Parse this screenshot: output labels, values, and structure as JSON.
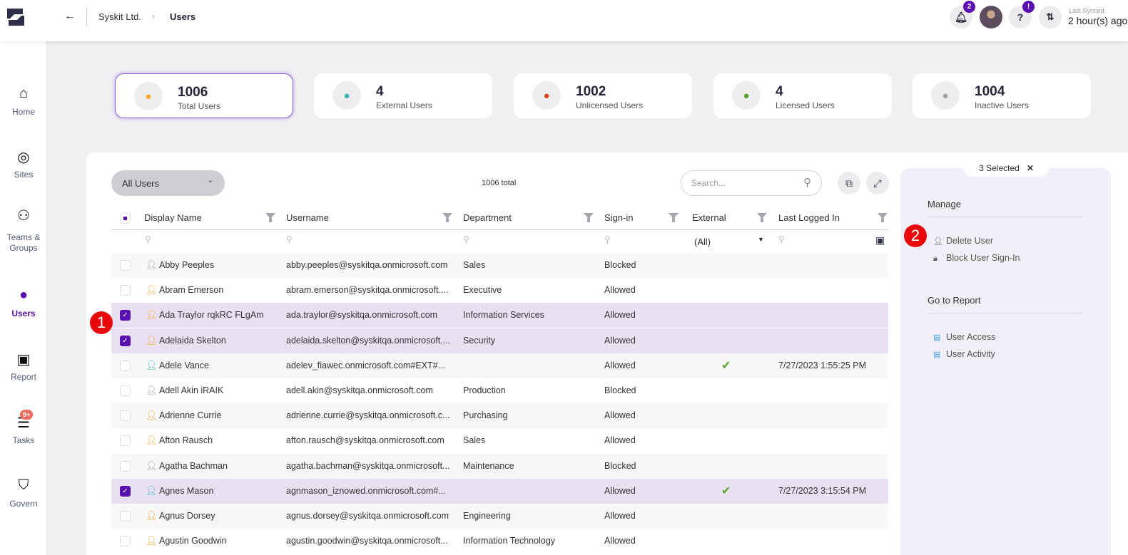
{
  "header": {
    "breadcrumb": [
      "Syskit Ltd.",
      "Users"
    ],
    "breadcrumb_sep": "›",
    "back": "←",
    "notifications_badge": "2",
    "help_badge": "!",
    "help": "?",
    "last_synced_label": "Last Synced:",
    "last_synced_value": "2 hour(s) ago"
  },
  "sidebar": {
    "items": [
      {
        "label": "Home",
        "icon": "home-icon"
      },
      {
        "label": "Sites",
        "icon": "globe-icon"
      },
      {
        "label": "Teams & Groups",
        "icon": "people-icon"
      },
      {
        "label": "Users",
        "icon": "user-icon",
        "active": true
      },
      {
        "label": "Report",
        "icon": "chart-icon"
      },
      {
        "label": "Tasks",
        "icon": "list-icon",
        "badge": "9+"
      },
      {
        "label": "Govern",
        "icon": "shield-icon"
      }
    ]
  },
  "stats": [
    {
      "value": "1006",
      "label": "Total Users",
      "color": "#f5a623"
    },
    {
      "value": "4",
      "label": "External Users",
      "color": "#3bb3b3"
    },
    {
      "value": "1002",
      "label": "Unlicensed Users",
      "color": "#d9441c"
    },
    {
      "value": "4",
      "label": "Licensed Users",
      "color": "#5aa02c"
    },
    {
      "value": "1004",
      "label": "Inactive Users",
      "color": "#a0a0a0"
    }
  ],
  "toolbar": {
    "view": "All Users",
    "total": "1006 total",
    "search_placeholder": "Search..."
  },
  "table": {
    "columns": [
      "Display Name",
      "Username",
      "Department",
      "Sign-in",
      "External",
      "Last Logged In"
    ],
    "external_filter": "(All)",
    "rows": [
      {
        "name": "Abby Peeples",
        "username": "abby.peeples@syskitqa.onmicrosoft.com",
        "department": "Sales",
        "signin": "Blocked",
        "external": false,
        "last": "",
        "type": "gray",
        "selected": false
      },
      {
        "name": "Abram Emerson",
        "username": "abram.emerson@syskitqa.onmicrosoft....",
        "department": "Executive",
        "signin": "Allowed",
        "external": false,
        "last": "",
        "type": "orange",
        "selected": false
      },
      {
        "name": "Ada Traylor rqkRC FLgAm",
        "username": "ada.traylor@syskitqa.onmicrosoft.com",
        "department": "Information Services",
        "signin": "Allowed",
        "external": false,
        "last": "",
        "type": "orange",
        "selected": true
      },
      {
        "name": "Adelaida Skelton",
        "username": "adelaida.skelton@syskitqa.onmicrosoft....",
        "department": "Security",
        "signin": "Allowed",
        "external": false,
        "last": "",
        "type": "orange",
        "selected": true
      },
      {
        "name": "Adele Vance",
        "username": "adelev_fiawec.onmicrosoft.com#EXT#...",
        "department": "",
        "signin": "Allowed",
        "external": true,
        "last": "7/27/2023 1:55:25 PM",
        "type": "teal",
        "selected": false
      },
      {
        "name": "Adell Akin iRAIK",
        "username": "adell.akin@syskitqa.onmicrosoft.com",
        "department": "Production",
        "signin": "Blocked",
        "external": false,
        "last": "",
        "type": "gray",
        "selected": false
      },
      {
        "name": "Adrienne Currie",
        "username": "adrienne.currie@syskitqa.onmicrosoft.c...",
        "department": "Purchasing",
        "signin": "Allowed",
        "external": false,
        "last": "",
        "type": "orange",
        "selected": false
      },
      {
        "name": "Afton Rausch",
        "username": "afton.rausch@syskitqa.onmicrosoft.com",
        "department": "Sales",
        "signin": "Allowed",
        "external": false,
        "last": "",
        "type": "orange",
        "selected": false
      },
      {
        "name": "Agatha Bachman",
        "username": "agatha.bachman@syskitqa.onmicrosoft...",
        "department": "Maintenance",
        "signin": "Blocked",
        "external": false,
        "last": "",
        "type": "gray",
        "selected": false
      },
      {
        "name": "Agnes Mason",
        "username": "agnmason_iznowed.onmicrosoft.com#...",
        "department": "",
        "signin": "Allowed",
        "external": true,
        "last": "7/27/2023 3:15:54 PM",
        "type": "teal",
        "selected": true
      },
      {
        "name": "Agnus Dorsey",
        "username": "agnus.dorsey@syskitqa.onmicrosoft.com",
        "department": "Engineering",
        "signin": "Allowed",
        "external": false,
        "last": "",
        "type": "orange",
        "selected": false
      },
      {
        "name": "Agustin Goodwin",
        "username": "agustin.goodwin@syskitqa.onmicrosoft...",
        "department": "Information Technology",
        "signin": "Allowed",
        "external": false,
        "last": "",
        "type": "orange",
        "selected": false
      }
    ]
  },
  "side_panel": {
    "selected": "3 Selected",
    "close": "✕",
    "manage_title": "Manage",
    "manage": [
      "Delete User",
      "Block User Sign-In"
    ],
    "report_title": "Go to Report",
    "reports": [
      "User Access",
      "User Activity"
    ]
  },
  "annotations": [
    "1",
    "2"
  ],
  "colors": {
    "accent": "#5a0fb0",
    "orange": "#f5a623",
    "teal": "#3bb3b3",
    "gray": "#a0a0a0",
    "check": "#5aa02c"
  }
}
